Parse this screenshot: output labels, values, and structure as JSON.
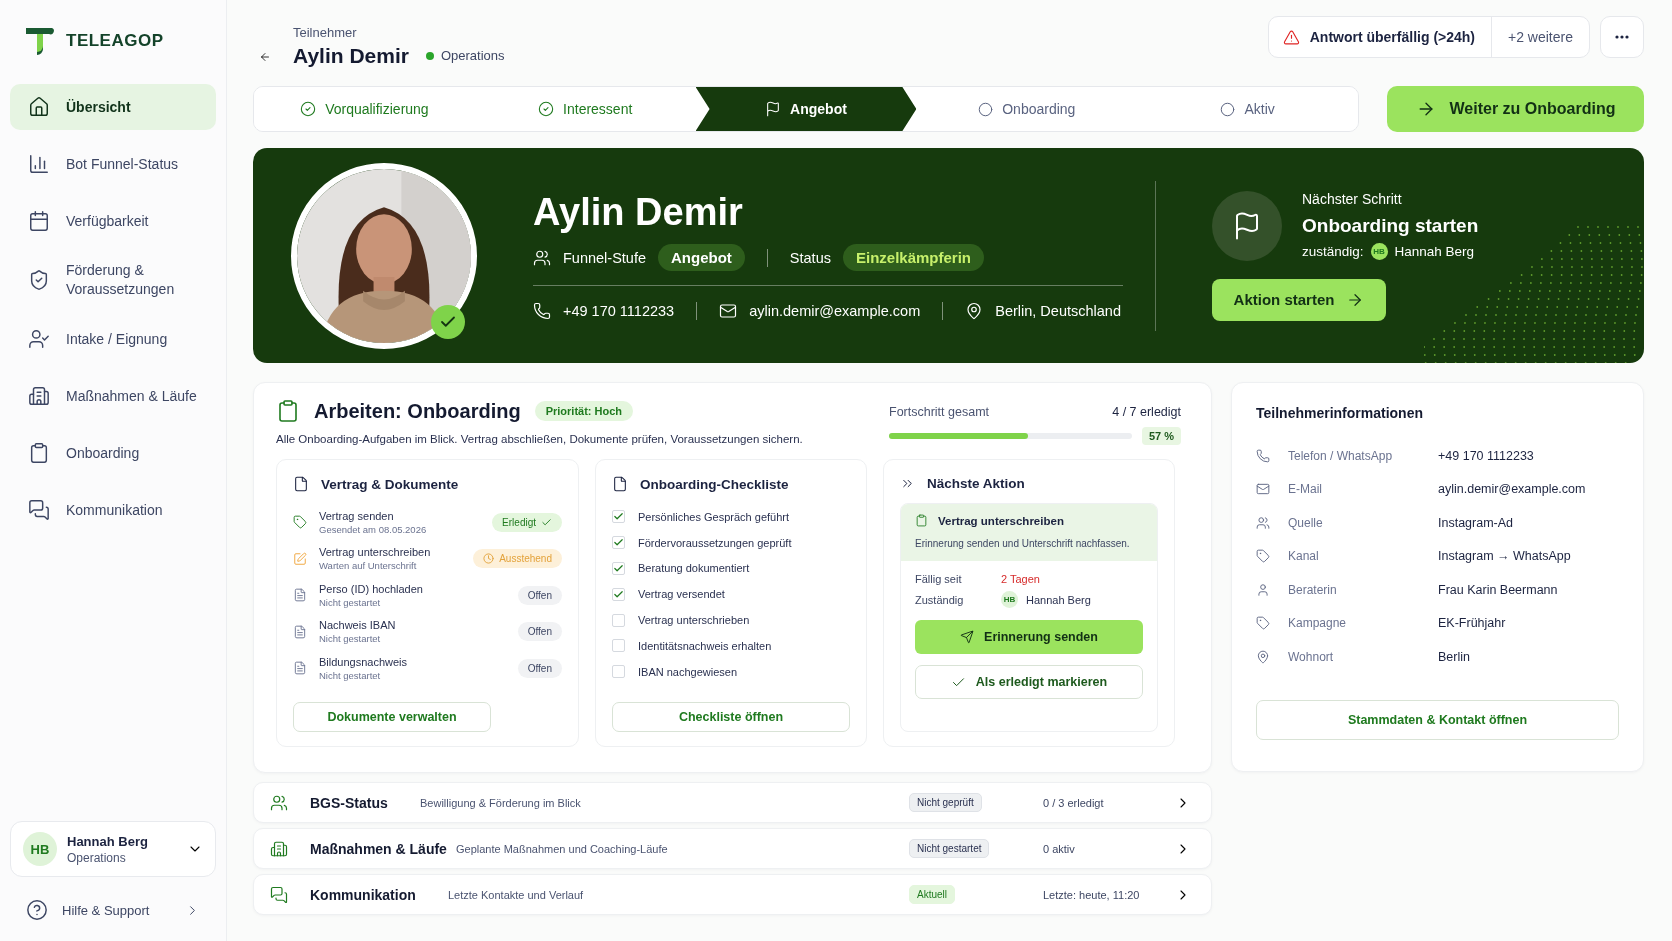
{
  "sidebar": {
    "brand": "TELEAGOP",
    "nav": [
      {
        "label": "Übersicht",
        "selected": true
      },
      {
        "label": "Bot Funnel-Status",
        "selected": false
      },
      {
        "label": "Verfügbarkeit",
        "selected": false
      },
      {
        "label": "Förderung & Voraussetzungen",
        "selected": false
      },
      {
        "label": "Intake / Eignung",
        "selected": false
      },
      {
        "label": "Maßnahmen & Läufe",
        "selected": false
      },
      {
        "label": "Onboarding",
        "selected": false
      },
      {
        "label": "Kommunikation",
        "selected": false
      }
    ],
    "user": {
      "initials": "HB",
      "name": "Hannah Berg",
      "role": "Operations"
    },
    "help": "Hilfe & Support"
  },
  "header": {
    "eyebrow": "Teilnehmer",
    "name": "Aylin Demir",
    "team": "Operations",
    "alert": "Antwort überfällig (>24h)",
    "more_alerts": "+2 weitere"
  },
  "stepper": [
    {
      "label": "Vorqualifizierung",
      "kind": "done",
      "selected": false
    },
    {
      "label": "Interessent",
      "kind": "done",
      "selected": false
    },
    {
      "label": "Angebot",
      "kind": "current",
      "selected": true
    },
    {
      "label": "Onboarding",
      "kind": "todo",
      "selected": false
    },
    {
      "label": "Aktiv",
      "kind": "todo",
      "selected": false
    }
  ],
  "next_button": "Weiter zu Onboarding",
  "hero": {
    "name": "Aylin Demir",
    "verified": true,
    "funnel_label": "Funnel-Stufe",
    "funnel_value": "Angebot",
    "status_label": "Status",
    "status_value": "Einzelkämpferin",
    "phone": "+49 170 1112233",
    "email": "aylin.demir@example.com",
    "location": "Berlin, Deutschland",
    "next": {
      "eyebrow": "Nächster Schritt",
      "title": "Onboarding starten",
      "owner_label": "zuständig:",
      "owner_initials": "HB",
      "owner": "Hannah Berg",
      "button": "Aktion starten"
    }
  },
  "work": {
    "title": "Arbeiten: Onboarding",
    "priority": "Priorität: Hoch",
    "description": "Alle Onboarding-Aufgaben im Blick. Vertrag abschließen, Dokumente prüfen, Voraussetzungen sichern.",
    "progress": {
      "label": "Fortschritt gesamt",
      "count": "4 / 7 erledigt",
      "level": 0.571,
      "percent": "57 %"
    },
    "documents": {
      "title": "Vertrag & Dokumente",
      "button": "Dokumente verwalten",
      "items": [
        {
          "title": "Vertrag senden",
          "sub": "Gesendet am 08.05.2026",
          "badge": "Erledigt",
          "kind": "done"
        },
        {
          "title": "Vertrag unterschreiben",
          "sub": "Warten auf Unterschrift",
          "badge": "Ausstehend",
          "kind": "pending"
        },
        {
          "title": "Perso (ID) hochladen",
          "sub": "Nicht gestartet",
          "badge": "Offen",
          "kind": "open"
        },
        {
          "title": "Nachweis IBAN",
          "sub": "Nicht gestartet",
          "badge": "Offen",
          "kind": "open"
        },
        {
          "title": "Bildungsnachweis",
          "sub": "Nicht gestartet",
          "badge": "Offen",
          "kind": "open"
        }
      ]
    },
    "checklist": {
      "title": "Onboarding-Checkliste",
      "button": "Checkliste öffnen",
      "items": [
        {
          "label": "Persönliches Gespräch geführt",
          "checked": true
        },
        {
          "label": "Fördervoraussetzungen geprüft",
          "checked": true
        },
        {
          "label": "Beratung dokumentiert",
          "checked": true
        },
        {
          "label": "Vertrag versendet",
          "checked": true
        },
        {
          "label": "Vertrag unterschrieben",
          "checked": false
        },
        {
          "label": "Identitätsnachweis erhalten",
          "checked": false
        },
        {
          "label": "IBAN nachgewiesen",
          "checked": false
        }
      ]
    },
    "next_action": {
      "title": "Nächste Aktion",
      "task": "Vertrag unterschreiben",
      "hint": "Erinnerung senden und Unterschrift nachfassen.",
      "due_label": "Fällig seit",
      "due_value": "2 Tagen",
      "owner_label": "Zuständig",
      "owner_initials": "HB",
      "owner": "Hannah Berg",
      "primary": "Erinnerung senden",
      "secondary": "Als erledigt markieren"
    }
  },
  "info": {
    "title": "Teilnehmerinformationen",
    "button": "Stammdaten & Kontakt öffnen",
    "rows": [
      {
        "label": "Telefon / WhatsApp",
        "value": "+49 170 1112233"
      },
      {
        "label": "E-Mail",
        "value": "aylin.demir@example.com"
      },
      {
        "label": "Quelle",
        "value": "Instagram-Ad"
      },
      {
        "label": "Kanal",
        "value": "Instagram → WhatsApp"
      },
      {
        "label": "Beraterin",
        "value": "Frau Karin Beermann"
      },
      {
        "label": "Kampagne",
        "value": "EK-Frühjahr"
      },
      {
        "label": "Wohnort",
        "value": "Berlin"
      }
    ]
  },
  "sections": [
    {
      "title": "BGS-Status",
      "description": "Bewilligung & Förderung im Blick",
      "badge": "Nicht geprüft",
      "kind": "neutral",
      "meta": "0 / 3 erledigt"
    },
    {
      "title": "Maßnahmen & Läufe",
      "description": "Geplante Maßnahmen und Coaching-Läufe",
      "badge": "Nicht gestartet",
      "kind": "neutral",
      "meta": "0 aktiv"
    },
    {
      "title": "Kommunikation",
      "description": "Letzte Kontakte und Verlauf",
      "badge": "Aktuell",
      "kind": "positive",
      "meta": "Letzte: heute, 11:20"
    }
  ]
}
